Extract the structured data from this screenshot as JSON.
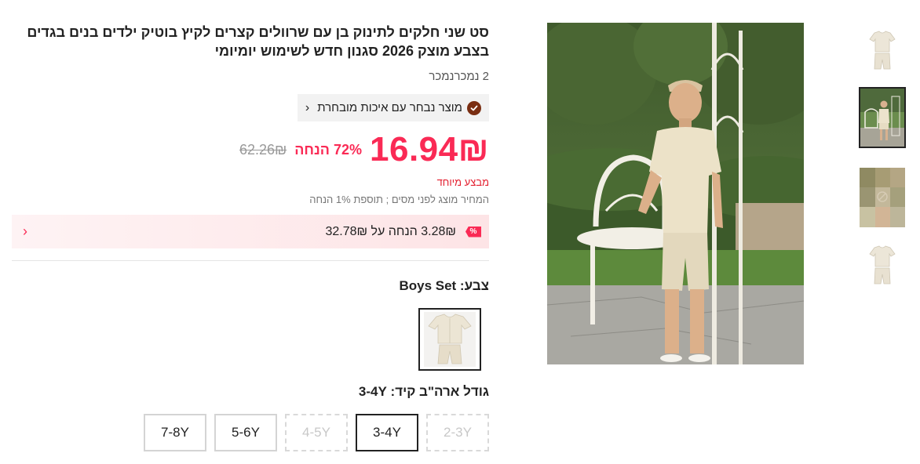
{
  "product": {
    "title": "סט שני חלקים לתינוק בן עם שרוולים קצרים לקיץ בוטיק ילדים בנים בגדים בצבע מוצק 2026 סגנון חדש לשימוש יומיומי",
    "sold": "2 נמכרנמכר",
    "quality_badge": "מוצר נבחר עם איכות מובחרת",
    "price": "16.94₪",
    "discount": "72% הנחה",
    "old_price": "62.26₪",
    "special_offer": "מבצע מיוחד",
    "tax_note": "המחיר מוצג לפני מסים ; תוספת 1% הנחה",
    "coupon": {
      "badge": "%",
      "text": "3.28₪ הנחה על 32.78₪"
    },
    "color": {
      "label": "צבע: Boys Set"
    },
    "size": {
      "label": "גודל ארה\"ב קיד: 3-4Y",
      "options": [
        {
          "label": "2-3Y",
          "state": "disabled"
        },
        {
          "label": "3-4Y",
          "state": "selected"
        },
        {
          "label": "4-5Y",
          "state": "disabled"
        },
        {
          "label": "5-6Y",
          "state": "available"
        },
        {
          "label": "7-8Y",
          "state": "available"
        }
      ]
    }
  },
  "gallery": {
    "thumbnails": [
      {
        "icon": "outfit-flatlay-thumbnail",
        "active": false
      },
      {
        "icon": "boy-photo-thumbnail",
        "active": true
      },
      {
        "icon": "color-palette-thumbnail",
        "active": false
      },
      {
        "icon": "outfit-flatlay-thumbnail",
        "active": false
      }
    ],
    "main_image_icon": "boy-wearing-set-photo"
  },
  "colors": {
    "accent": "#fa2a55",
    "special_red": "#e31e2e",
    "badge_brown": "#7a2e12",
    "coupon_bg": "#fde4e6"
  }
}
